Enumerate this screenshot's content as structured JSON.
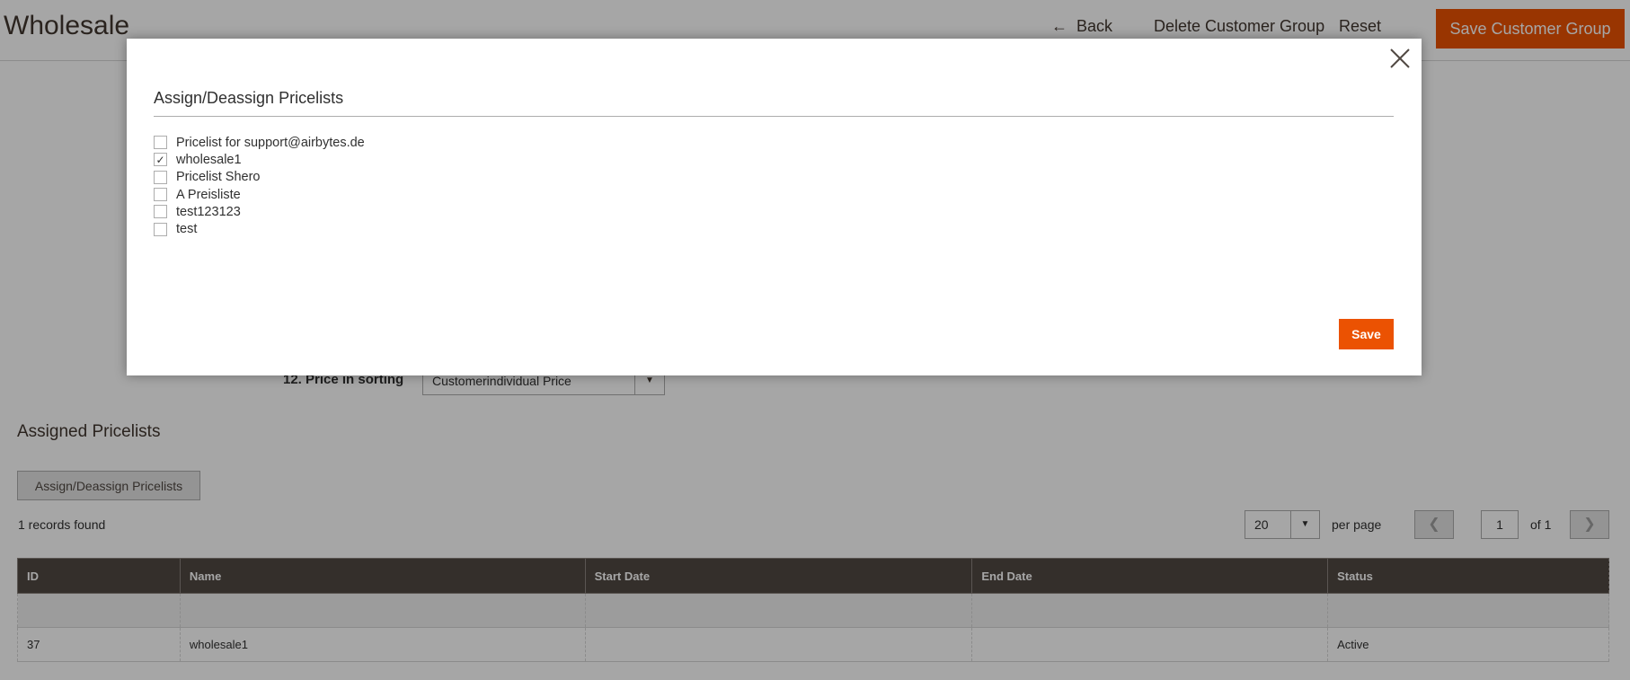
{
  "header": {
    "title": "Wholesale",
    "back_label": "Back",
    "back_icon": "arrow-left-icon",
    "delete_label": "Delete Customer Group",
    "reset_label": "Reset",
    "save_label": "Save Customer Group"
  },
  "form": {
    "price_sorting_label": "12. Price in sorting",
    "price_sorting_value": "Customerindividual Price"
  },
  "assigned": {
    "section_title": "Assigned Pricelists",
    "assign_button_label": "Assign/Deassign Pricelists",
    "records_found": "1 records found",
    "per_page_value": "20",
    "per_page_label": "per page",
    "current_page": "1",
    "page_of": "of 1",
    "columns": [
      "ID",
      "Name",
      "Start Date",
      "End Date",
      "Status"
    ],
    "rows": [
      {
        "id": "37",
        "name": "wholesale1",
        "start": "",
        "end": "",
        "status": "Active"
      }
    ]
  },
  "modal": {
    "title": "Assign/Deassign Pricelists",
    "items": [
      {
        "label": "Pricelist for support@airbytes.de",
        "checked": false
      },
      {
        "label": "wholesale1",
        "checked": true
      },
      {
        "label": "Pricelist Shero",
        "checked": false
      },
      {
        "label": "A Preisliste",
        "checked": false
      },
      {
        "label": "test123123",
        "checked": false
      },
      {
        "label": "test",
        "checked": false
      }
    ],
    "save_label": "Save"
  },
  "colors": {
    "accent": "#eb5202",
    "grid_header": "#514943"
  }
}
